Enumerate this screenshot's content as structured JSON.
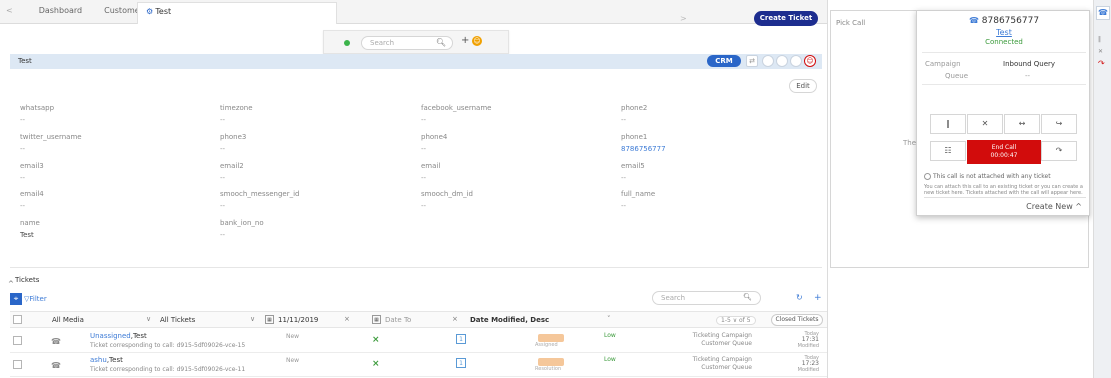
{
  "tabs": {
    "back_chevron": "<",
    "dashboard": "Dashboard",
    "customers": "Customers",
    "active": "Test",
    "active_icon": "⚙"
  },
  "header": {
    "create_ticket": "Create Ticket",
    "next_chevron": ">"
  },
  "search_popup": {
    "placeholder": "Search",
    "plus": "+"
  },
  "title_bar": {
    "title": "Test",
    "crm": "CRM",
    "edit": "Edit"
  },
  "fields": [
    {
      "label": "whatsapp",
      "value": "--"
    },
    {
      "label": "timezone",
      "value": "--"
    },
    {
      "label": "facebook_username",
      "value": "--"
    },
    {
      "label": "phone2",
      "value": "--"
    },
    {
      "label": "twitter_username",
      "value": "--"
    },
    {
      "label": "phone3",
      "value": "--"
    },
    {
      "label": "phone4",
      "value": "--"
    },
    {
      "label": "phone1",
      "value": "8786756777"
    },
    {
      "label": "email3",
      "value": "--"
    },
    {
      "label": "email2",
      "value": "--"
    },
    {
      "label": "email",
      "value": "--"
    },
    {
      "label": "email5",
      "value": "--"
    },
    {
      "label": "email4",
      "value": "--"
    },
    {
      "label": "smooch_messenger_id",
      "value": "--"
    },
    {
      "label": "smooch_dm_id",
      "value": "--"
    },
    {
      "label": "full_name",
      "value": "--"
    },
    {
      "label": "name",
      "value": "Test"
    },
    {
      "label": "bank_ion_no",
      "value": "--"
    }
  ],
  "tickets": {
    "title": "Tickets",
    "filter": "Filter",
    "search_placeholder": "Search",
    "header": {
      "all_media": "All Media",
      "all_tickets": "All Tickets",
      "date_from": "11/11/2019",
      "date_to": "Date To",
      "sort": "Date Modified, Desc",
      "pager": "1-5 ∨ of 5",
      "closed": "Closed Tickets"
    },
    "rows": [
      {
        "assignee": "Unassigned",
        "name": "Test",
        "subtitle": "Ticket corresponding to call: d915-5df09026-vce-15",
        "status": "New",
        "badge_label": "Assigned",
        "priority": "Low",
        "campaign": "Ticketing Campaign",
        "queue": "Customer Queue",
        "date": "Today",
        "time": "17:31",
        "modified": "Modified"
      },
      {
        "assignee": "ashu",
        "name": "Test",
        "subtitle": "Ticket corresponding to call: d915-5df09026-vce-11",
        "status": "New",
        "badge_label": "Resolution",
        "priority": "Low",
        "campaign": "Ticketing Campaign",
        "queue": "Customer Queue",
        "date": "Today",
        "time": "17:23",
        "modified": "Modified"
      }
    ]
  },
  "call_panel": {
    "pick_call": "Pick Call",
    "there": "Ther",
    "phone": "8786756777",
    "name": "Test",
    "status": "Connected",
    "campaign_label": "Campaign",
    "campaign_value": "Inbound Query",
    "queue_label": "Queue",
    "queue_value": "--",
    "end_call": "End Call",
    "timer": "00:00:47",
    "note": "This call is not attached with any ticket",
    "para": "You can attach this call to an existing ticket or you can create a new ticket here. Tickets attached with the call will appear here.",
    "create_new": "Create New ^"
  }
}
